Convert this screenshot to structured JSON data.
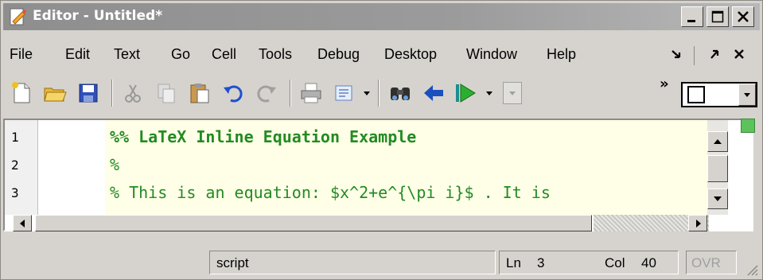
{
  "window": {
    "title": "Editor - Untitled*",
    "title_icon": "editor-document-icon"
  },
  "menu": {
    "items": [
      "File",
      "Edit",
      "Text",
      "Go",
      "Cell",
      "Tools",
      "Debug",
      "Desktop",
      "Window",
      "Help"
    ]
  },
  "toolbar": {
    "buttons": [
      "new-file-icon",
      "open-folder-icon",
      "save-icon",
      "cut-icon",
      "copy-icon",
      "paste-icon",
      "undo-icon",
      "redo-icon",
      "print-icon",
      "find-files-icon",
      "find-icon",
      "back-arrow-icon",
      "run-icon"
    ],
    "overflow": "»"
  },
  "editor": {
    "line_numbers": [
      "1",
      "2",
      "3"
    ],
    "lines": [
      "%% LaTeX Inline Equation Example",
      "%",
      "% This is an equation: $x^2+e^{\\pi i}$ . It is"
    ],
    "comment_color": "#228b22",
    "cell_highlight_color": "#ffffe8"
  },
  "statusbar": {
    "mode": "script",
    "ln_label": "Ln",
    "ln_value": "3",
    "col_label": "Col",
    "col_value": "40",
    "ovr": "OVR"
  }
}
